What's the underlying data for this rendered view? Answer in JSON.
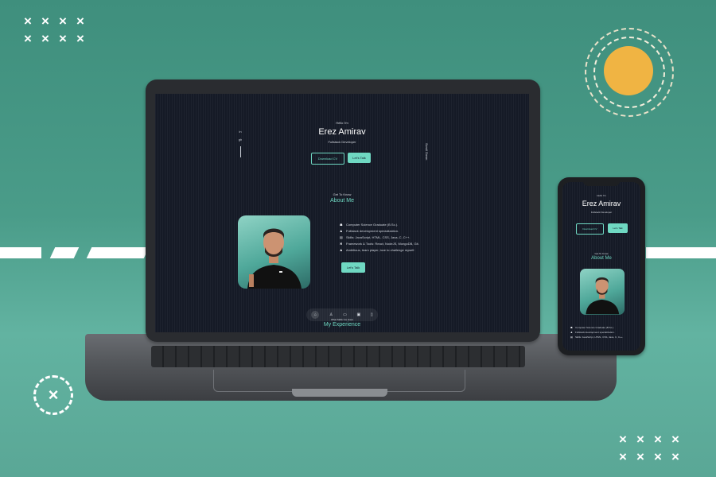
{
  "decor": {
    "x_glyph": "×",
    "close_glyph": "×"
  },
  "site": {
    "greeting": "Hello I'm",
    "name": "Erez Amirav",
    "role": "Fullstack Developer",
    "download_cv": "Download CV",
    "lets_talk": "Let's Talk",
    "scroll_down": "Scroll Down",
    "socials": [
      "in",
      "gh"
    ],
    "about_kicker": "Get To Know",
    "about_title": "About Me",
    "about_items": [
      {
        "icon": "graduation-icon",
        "glyph": "☗",
        "text": "Computer Science Graduate (B.Sc.)."
      },
      {
        "icon": "user-icon",
        "glyph": "♟",
        "text": "Fullstack development specialization."
      },
      {
        "icon": "code-icon",
        "glyph": "▤",
        "text": "Skills: JavaScript, HTML, CSS, Java, C, C++."
      },
      {
        "icon": "tools-icon",
        "glyph": "✖",
        "text": "Framework & Tools: React, NodeJS, MongoDB, Git."
      },
      {
        "icon": "person-icon",
        "glyph": "♟",
        "text": "Ambitious, team player, love to challenge myself."
      }
    ],
    "about_button": "Let's Talk",
    "nav_icons": [
      {
        "name": "home-icon",
        "glyph": "⌂"
      },
      {
        "name": "user-icon",
        "glyph": "♙"
      },
      {
        "name": "book-icon",
        "glyph": "▭"
      },
      {
        "name": "briefcase-icon",
        "glyph": "▣"
      },
      {
        "name": "message-icon",
        "glyph": "▯"
      }
    ],
    "exp_kicker": "What Skills I've Have",
    "exp_title": "My Experience"
  },
  "colors": {
    "accent": "#6fd8c2",
    "background": "#151a26",
    "sun": "#f0b443",
    "scene": "#4a9c89"
  }
}
